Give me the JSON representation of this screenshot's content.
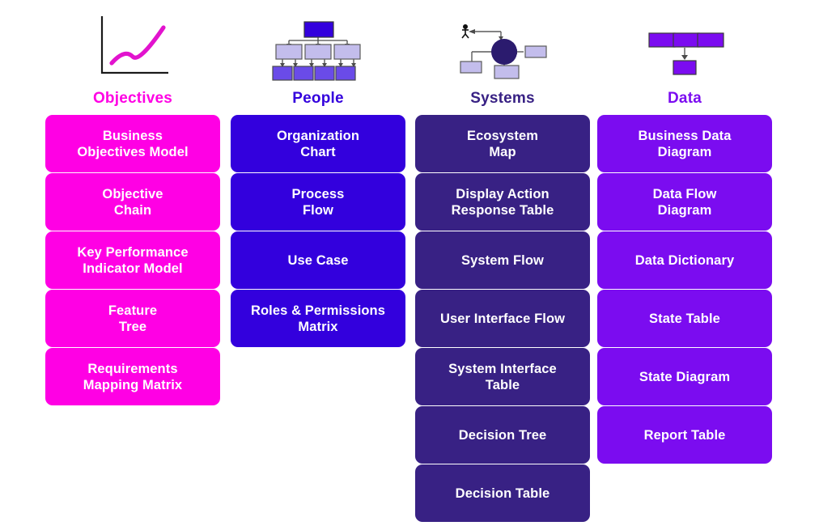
{
  "columns": [
    {
      "key": "objectives",
      "header": "Objectives",
      "color": "#FF00E4",
      "icon": "line-chart-icon",
      "cards": [
        "Business\nObjectives Model",
        "Objective\nChain",
        "Key Performance\nIndicator Model",
        "Feature\nTree",
        "Requirements\nMapping Matrix"
      ]
    },
    {
      "key": "people",
      "header": "People",
      "color": "#3300DD",
      "icon": "org-chart-icon",
      "cards": [
        "Organization\nChart",
        "Process\nFlow",
        "Use Case",
        "Roles & Permissions\nMatrix"
      ]
    },
    {
      "key": "systems",
      "header": "Systems",
      "color": "#382184",
      "icon": "ecosystem-map-icon",
      "cards": [
        "Ecosystem\nMap",
        "Display Action\nResponse Table",
        "System Flow",
        "User Interface Flow",
        "System Interface\nTable",
        "Decision Tree",
        "Decision Table"
      ]
    },
    {
      "key": "data",
      "header": "Data",
      "color": "#7B0CF0",
      "icon": "data-flow-icon",
      "cards": [
        "Business Data\nDiagram",
        "Data Flow\nDiagram",
        "Data Dictionary",
        "State Table",
        "State Diagram",
        "Report Table"
      ]
    }
  ]
}
